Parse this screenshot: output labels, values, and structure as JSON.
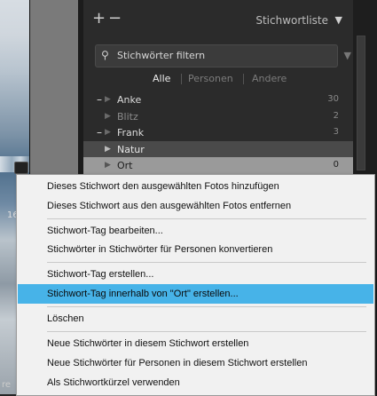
{
  "left_strip": {
    "fragment_1": "16",
    "fragment_2": "re"
  },
  "panel": {
    "title": "Stichwortliste",
    "add_symbol": "+",
    "remove_symbol": "−",
    "collapse_symbol": "▼",
    "search_placeholder": "Stichwörter filtern",
    "tabs": [
      "Alle",
      "Personen",
      "Andere"
    ],
    "active_tab": "Alle"
  },
  "keywords": [
    {
      "name": "Anke",
      "count": "30",
      "marker": "–"
    },
    {
      "name": "Blitz",
      "count": "2",
      "marker": ""
    },
    {
      "name": "Frank",
      "count": "3",
      "marker": "–"
    },
    {
      "name": "Natur",
      "count": "",
      "marker": ""
    },
    {
      "name": "Ort",
      "count": "0",
      "marker": ""
    }
  ],
  "context_menu": {
    "items": [
      "Dieses Stichwort den ausgewählten Fotos hinzufügen",
      "Dieses Stichwort aus den ausgewählten Fotos entfernen",
      "Stichwort-Tag bearbeiten...",
      "Stichwörter in Stichwörter für Personen konvertieren",
      "Stichwort-Tag erstellen...",
      "Stichwort-Tag innerhalb von \"Ort\" erstellen...",
      "Löschen",
      "Neue Stichwörter in diesem Stichwort erstellen",
      "Neue Stichwörter für Personen in diesem Stichwort erstellen",
      "Als Stichwortkürzel verwenden"
    ],
    "highlighted_index": 5
  },
  "colors": {
    "highlight": "#47b3e8",
    "panel_bg": "#2b2b2b",
    "menu_bg": "#f1f1f1"
  }
}
